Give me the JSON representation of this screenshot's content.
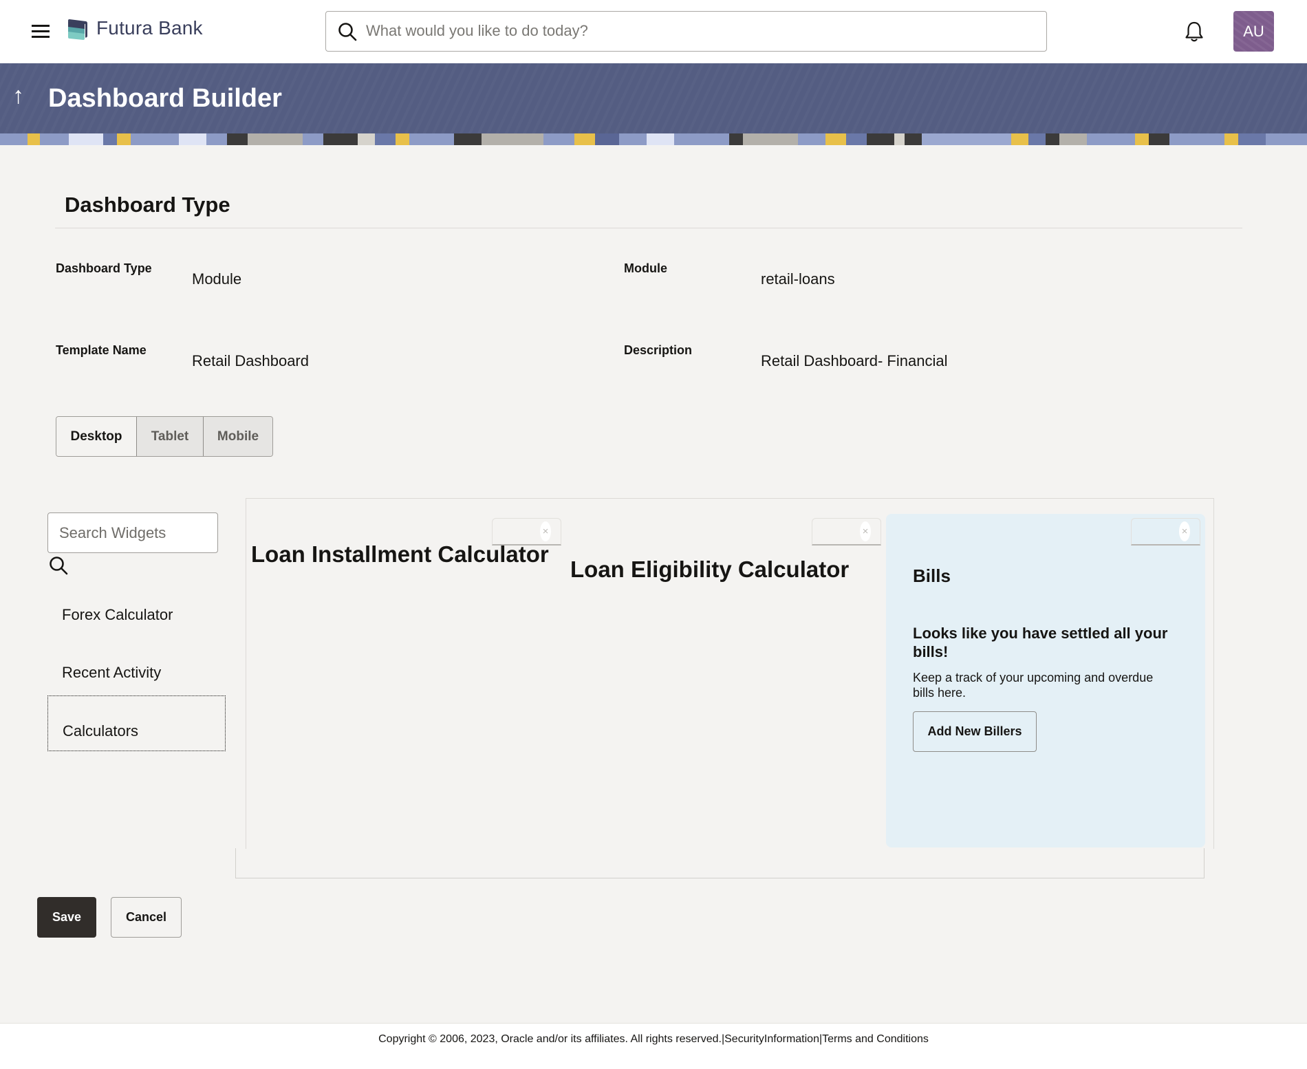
{
  "header": {
    "brand_name": "Futura Bank",
    "search_placeholder": "What would you like to do today?",
    "avatar_initials": "AU",
    "icons": {
      "menu": "hamburger-icon",
      "search": "search-icon",
      "notifications": "bell-icon"
    }
  },
  "banner": {
    "title": "Dashboard Builder",
    "back_icon": "↑"
  },
  "section": {
    "title": "Dashboard Type"
  },
  "fields": [
    {
      "label": "Dashboard Type",
      "value": "Module"
    },
    {
      "label": "Module",
      "value": "retail-loans"
    },
    {
      "label": "Template Name",
      "value": "Retail Dashboard"
    },
    {
      "label": "Description",
      "value": "Retail Dashboard- Financial"
    }
  ],
  "device_toggle": {
    "options": [
      "Desktop",
      "Tablet",
      "Mobile"
    ],
    "selected": "Desktop"
  },
  "widget_panel": {
    "search_placeholder": "Search Widgets",
    "items": [
      "Forex Calculator",
      "Recent Activity",
      "Calculators"
    ],
    "focused_item": "Calculators"
  },
  "canvas": {
    "widgets": [
      {
        "title": "Loan Installment Calculator",
        "close_icon": "×"
      },
      {
        "title": "Loan Eligibility Calculator",
        "close_icon": "×"
      },
      {
        "title": "Bills",
        "close_icon": "×",
        "empty_heading": "Looks like you have settled all your bills!",
        "empty_text": "Keep a track of your upcoming and overdue bills here.",
        "action_label": "Add New Billers"
      }
    ]
  },
  "actions": {
    "save_label": "Save",
    "cancel_label": "Cancel"
  },
  "footer": {
    "copyright": "Copyright © 2006, 2023, Oracle and/or its affiliates. All rights reserved.",
    "separator": "|",
    "security_link": "SecurityInformation",
    "terms_link": "Terms and Conditions"
  },
  "colors": {
    "banner": "#545d82",
    "avatar": "#7e5d8d",
    "primary_button": "#312d2a",
    "bills_card": "#e4f0f6",
    "page_background": "#f4f3f1"
  }
}
